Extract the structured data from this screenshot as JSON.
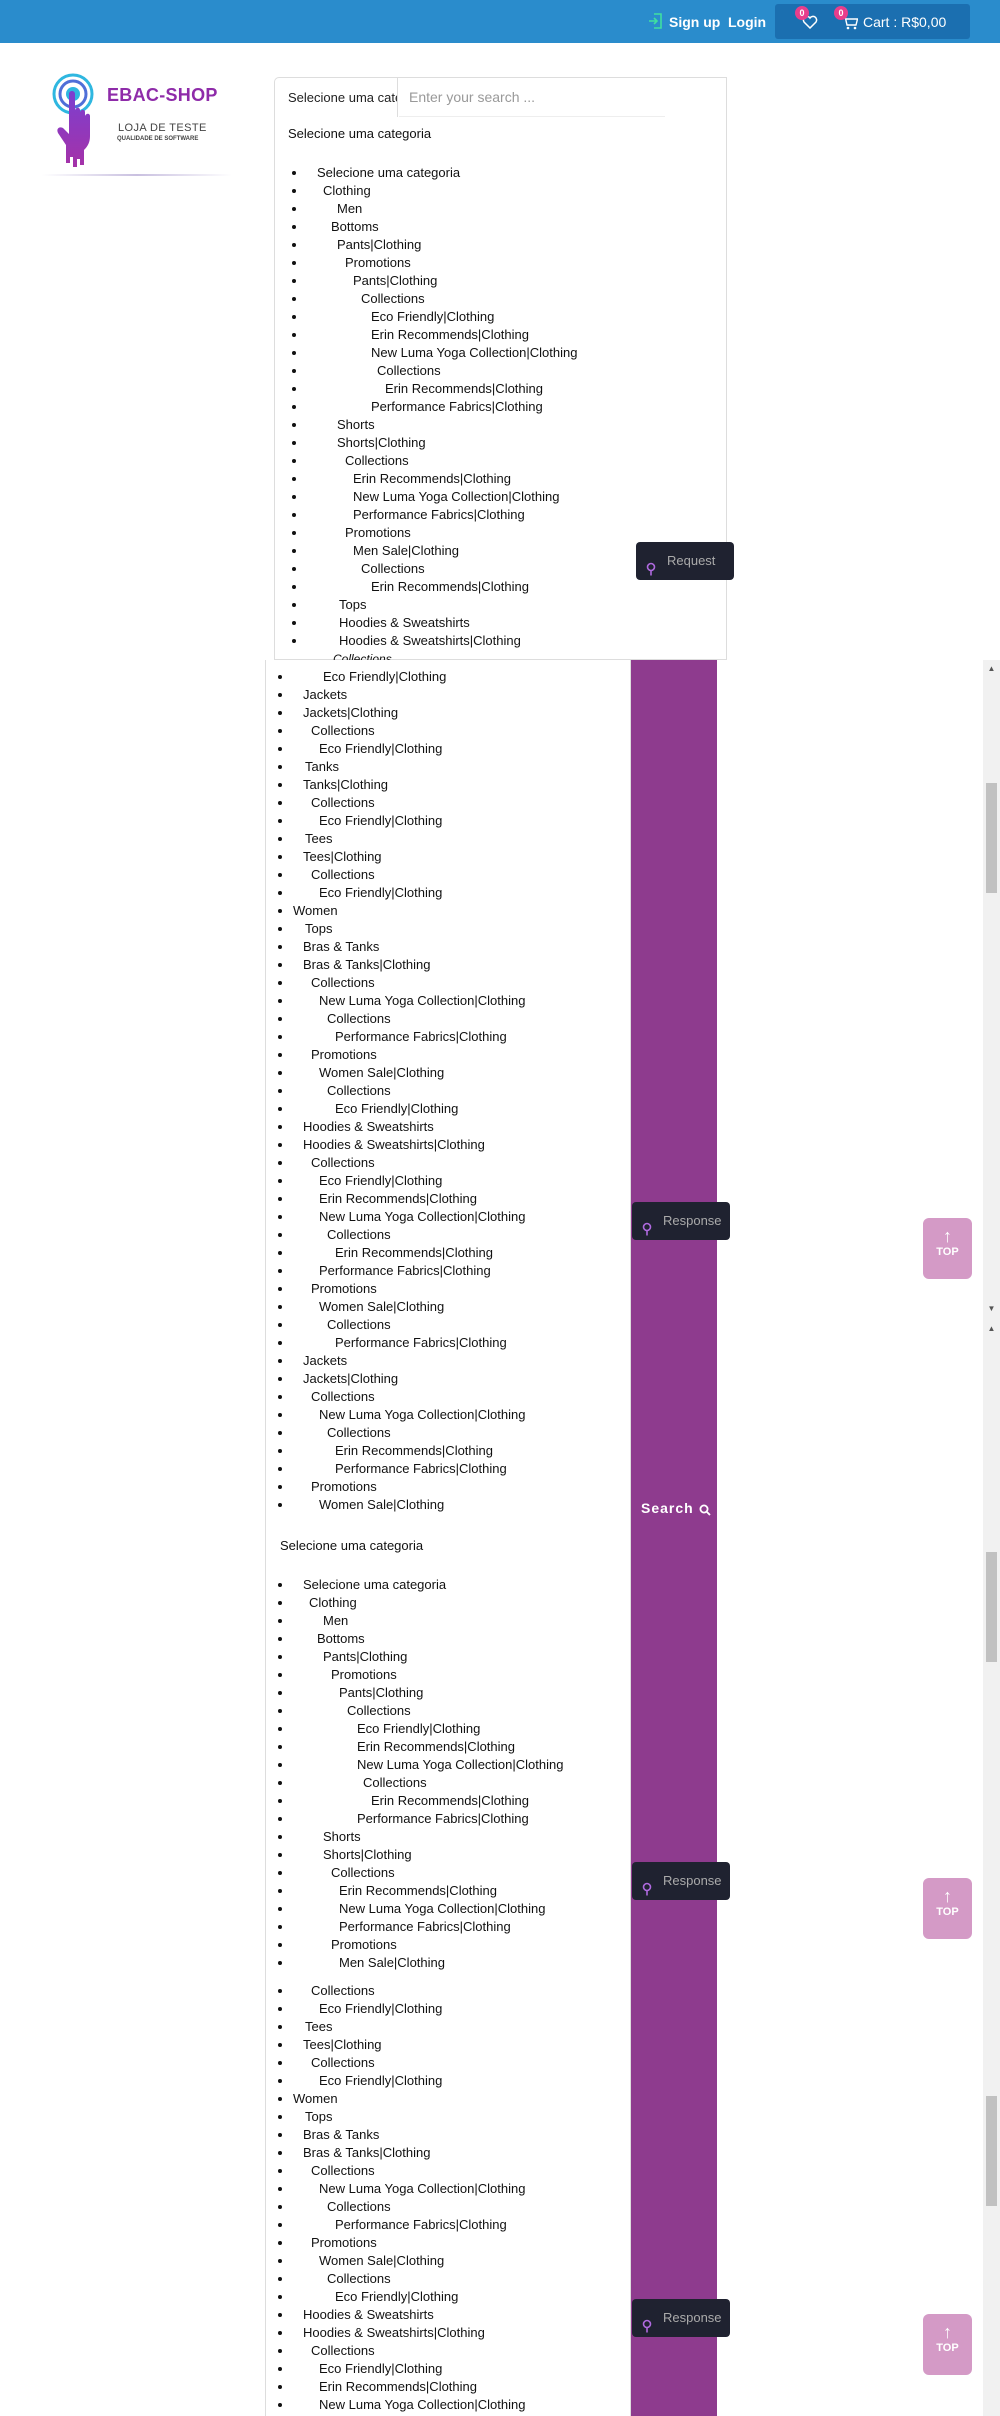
{
  "header": {
    "signup": "Sign up",
    "login": "Login",
    "wishlist_count": "0",
    "cart_count": "0",
    "cart_label": "Cart : R$0,00"
  },
  "brand": {
    "name": "EBAC-SHOP",
    "sub1": "LOJA DE TESTE",
    "sub2": "QUALIDADE DE SOFTWARE"
  },
  "search": {
    "category_select": "Selecione uma categoria",
    "placeholder": "Enter your search ...",
    "heading": "Selecione uma categoria",
    "search_label": "Search"
  },
  "buttons": {
    "request": "Request",
    "response": "Response",
    "top": "TOP"
  },
  "tree1": [
    "Selecione uma categoria",
    "Clothing",
    "Men",
    "Bottoms",
    "Pants|Clothing",
    "Promotions",
    "Pants|Clothing",
    "Collections",
    "Eco Friendly|Clothing",
    "Erin Recommends|Clothing",
    "New Luma Yoga Collection|Clothing",
    "Collections",
    "Erin Recommends|Clothing",
    "Performance Fabrics|Clothing",
    "Shorts",
    "Shorts|Clothing",
    "Collections",
    "Erin Recommends|Clothing",
    "New Luma Yoga Collection|Clothing",
    "Performance Fabrics|Clothing",
    "Promotions",
    "Men Sale|Clothing",
    "Collections",
    "Erin Recommends|Clothing",
    "Tops",
    "Hoodies & Sweatshirts",
    "Hoodies & Sweatshirts|Clothing"
  ],
  "tree1_clip": "Collections",
  "tree2": [
    "Eco Friendly|Clothing",
    "Jackets",
    "Jackets|Clothing",
    "Collections",
    "Eco Friendly|Clothing",
    "Tanks",
    "Tanks|Clothing",
    "Collections",
    "Eco Friendly|Clothing",
    "Tees",
    "Tees|Clothing",
    "Collections",
    "Eco Friendly|Clothing",
    "Women",
    "Tops",
    "Bras & Tanks",
    "Bras & Tanks|Clothing",
    "Collections",
    "New Luma Yoga Collection|Clothing",
    "Collections",
    "Performance Fabrics|Clothing",
    "Promotions",
    "Women Sale|Clothing",
    "Collections",
    "Eco Friendly|Clothing",
    "Hoodies & Sweatshirts",
    "Hoodies & Sweatshirts|Clothing",
    "Collections",
    "Eco Friendly|Clothing",
    "Erin Recommends|Clothing",
    "New Luma Yoga Collection|Clothing",
    "Collections",
    "Erin Recommends|Clothing",
    "Performance Fabrics|Clothing",
    "Promotions",
    "Women Sale|Clothing",
    "Collections",
    "Performance Fabrics|Clothing",
    "Jackets",
    "Jackets|Clothing",
    "Collections",
    "New Luma Yoga Collection|Clothing",
    "Collections",
    "Erin Recommends|Clothing",
    "Performance Fabrics|Clothing",
    "Promotions",
    "Women Sale|Clothing"
  ],
  "tree3": [
    "Selecione uma categoria",
    "Clothing",
    "Men",
    "Bottoms",
    "Pants|Clothing",
    "Promotions",
    "Pants|Clothing",
    "Collections",
    "Eco Friendly|Clothing",
    "Erin Recommends|Clothing",
    "New Luma Yoga Collection|Clothing",
    "Collections",
    "Erin Recommends|Clothing",
    "Performance Fabrics|Clothing",
    "Shorts",
    "Shorts|Clothing",
    "Collections",
    "Erin Recommends|Clothing",
    "New Luma Yoga Collection|Clothing",
    "Performance Fabrics|Clothing",
    "Promotions",
    "Men Sale|Clothing"
  ],
  "tree4": [
    "Collections",
    "Eco Friendly|Clothing",
    "Tees",
    "Tees|Clothing",
    "Collections",
    "Eco Friendly|Clothing",
    "Women",
    "Tops",
    "Bras & Tanks",
    "Bras & Tanks|Clothing",
    "Collections",
    "New Luma Yoga Collection|Clothing",
    "Collections",
    "Performance Fabrics|Clothing",
    "Promotions",
    "Women Sale|Clothing",
    "Collections",
    "Eco Friendly|Clothing",
    "Hoodies & Sweatshirts",
    "Hoodies & Sweatshirts|Clothing",
    "Collections",
    "Eco Friendly|Clothing",
    "Erin Recommends|Clothing",
    "New Luma Yoga Collection|Clothing"
  ]
}
